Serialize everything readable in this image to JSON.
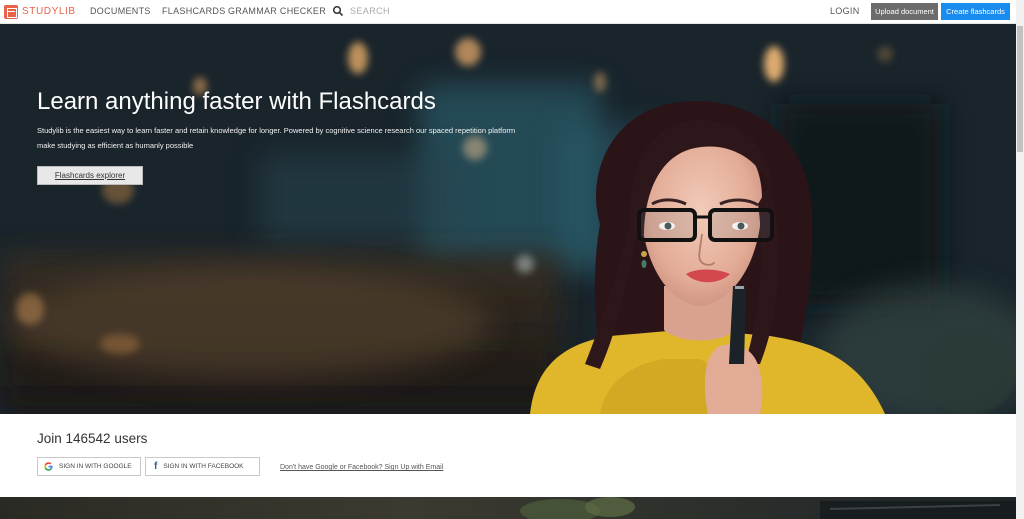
{
  "nav": {
    "logo_text": "STUDYLIB",
    "links": [
      "DOCUMENTS",
      "FLASHCARDS",
      "GRAMMAR CHECKER"
    ],
    "search_placeholder": "SEARCH",
    "login": "LOGIN",
    "upload_button": "Upload document",
    "create_button": "Create flashcards"
  },
  "hero": {
    "title": "Learn anything faster with Flashcards",
    "description": "Studylib is the easiest way to learn faster and retain knowledge for longer. Powered by cognitive science research our spaced repetition platform make studying as efficient as humanly possible",
    "explorer_button": "Flashcards explorer"
  },
  "join": {
    "title": "Join 146542 users",
    "google_button": "SIGN IN WITH GOOGLE",
    "facebook_button": "SIGN IN WITH FACEBOOK",
    "email_link": "Don't have Google or Facebook? Sign Up with Email"
  },
  "colors": {
    "brand": "#e8624a",
    "primary_button": "#1a8cf0",
    "secondary_button": "#6c6c6c",
    "facebook": "#3b5998"
  },
  "icons": {
    "logo": "studylib-logo-icon",
    "search": "search-icon",
    "google": "google-icon",
    "facebook": "facebook-icon"
  }
}
